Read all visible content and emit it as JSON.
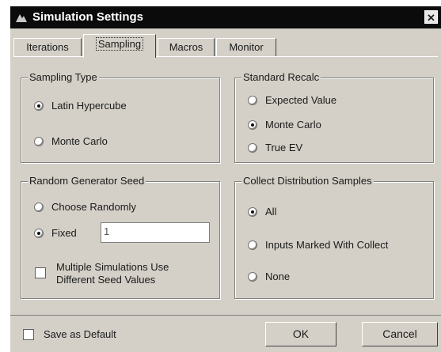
{
  "window": {
    "title": "Simulation Settings",
    "close_glyph": "✕"
  },
  "tabs": [
    {
      "label": "Iterations",
      "active": false
    },
    {
      "label": "Sampling",
      "active": true
    },
    {
      "label": "Macros",
      "active": false
    },
    {
      "label": "Monitor",
      "active": false
    }
  ],
  "sampling_type": {
    "legend": "Sampling Type",
    "options": [
      {
        "label": "Latin Hypercube",
        "selected": true
      },
      {
        "label": "Monte Carlo",
        "selected": false
      }
    ]
  },
  "standard_recalc": {
    "legend": "Standard Recalc",
    "options": [
      {
        "label": "Expected Value",
        "selected": false
      },
      {
        "label": "Monte Carlo",
        "selected": true
      },
      {
        "label": "True EV",
        "selected": false
      }
    ]
  },
  "random_seed": {
    "legend": "Random Generator Seed",
    "choose_randomly": "Choose Randomly",
    "fixed": "Fixed",
    "fixed_value": "1",
    "fixed_selected": true,
    "multiple_sims_line1": "Multiple Simulations Use",
    "multiple_sims_line2": "Different Seed Values",
    "multiple_sims_checked": false
  },
  "collect_samples": {
    "legend": "Collect Distribution Samples",
    "options": [
      {
        "label": "All",
        "selected": true
      },
      {
        "label": "Inputs Marked With Collect",
        "selected": false
      },
      {
        "label": "None",
        "selected": false
      }
    ]
  },
  "footer": {
    "save_default": "Save as Default",
    "save_default_checked": false,
    "ok": "OK",
    "cancel": "Cancel"
  },
  "colors": {
    "titlebar": "#0b0b0b",
    "face": "#d4d0c8"
  }
}
